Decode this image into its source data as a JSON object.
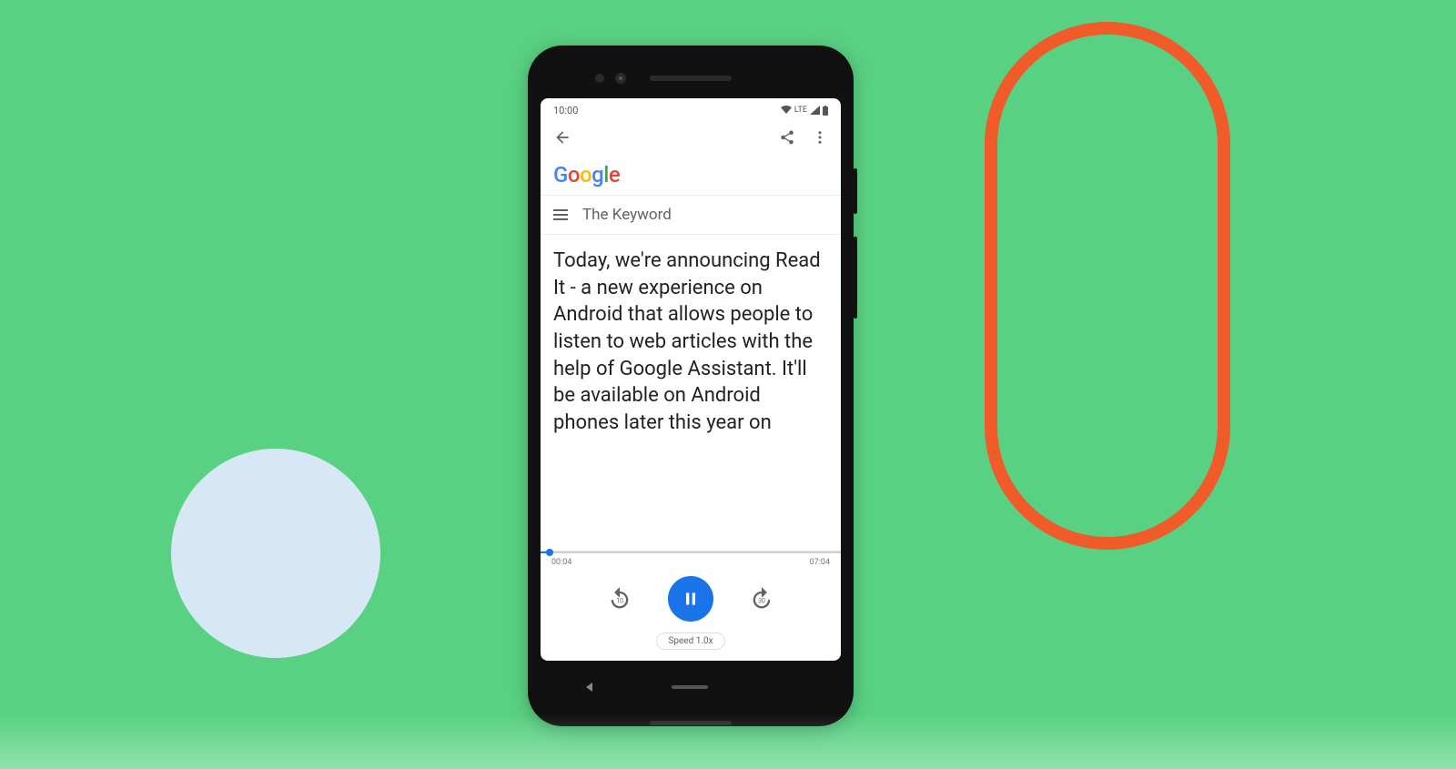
{
  "status": {
    "time": "10:00",
    "network": "LTE"
  },
  "site": {
    "title": "The Keyword"
  },
  "article": {
    "body": "Today, we're announcing Read It - a new experience on Android that allows people to listen to web articles with the help of Google Assistant. It'll be available on Android phones later this year on"
  },
  "player": {
    "elapsed": "00:04",
    "total": "07:04",
    "speed_label": "Speed 1.0x",
    "progress_percent": 3
  },
  "google_logo": {
    "g1": "G",
    "o1": "o",
    "o2": "o",
    "g2": "g",
    "l": "l",
    "e": "e"
  }
}
